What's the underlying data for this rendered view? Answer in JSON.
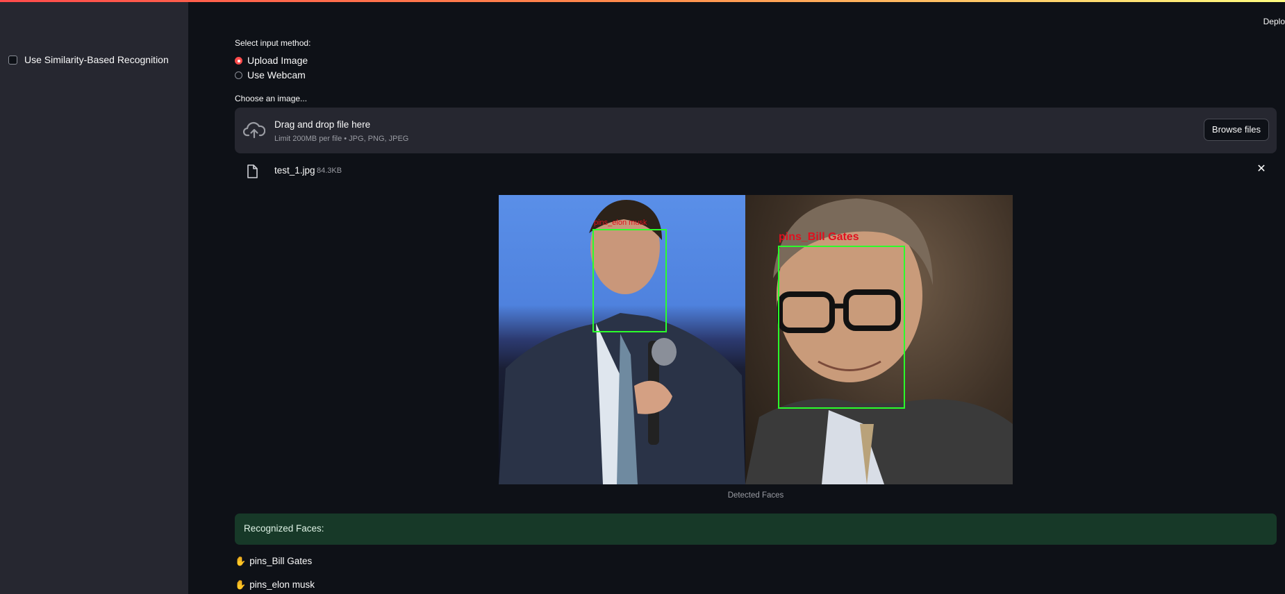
{
  "header": {
    "deploy_label": "Deplo"
  },
  "sidebar": {
    "similarity_checkbox_label": "Use Similarity-Based Recognition",
    "similarity_checked": false
  },
  "input_method": {
    "label": "Select input method:",
    "options": [
      {
        "label": "Upload Image",
        "selected": true
      },
      {
        "label": "Use Webcam",
        "selected": false
      }
    ]
  },
  "uploader": {
    "label": "Choose an image...",
    "title": "Drag and drop file here",
    "limit_text": "Limit 200MB per file • JPG, PNG, JPEG",
    "browse_label": "Browse files",
    "file": {
      "name": "test_1.jpg",
      "size": "84.3KB"
    }
  },
  "image": {
    "caption": "Detected Faces",
    "labels": [
      "pins_elon musk",
      "pins_Bill Gates"
    ]
  },
  "results": {
    "heading": "Recognized Faces:",
    "faces": [
      "pins_Bill Gates",
      "pins_elon musk"
    ]
  },
  "colors": {
    "accent": "#ff4b4b",
    "success_bg": "#173928",
    "box_green": "#2bff2b",
    "box_label_red": "#e0101f"
  },
  "icons": {
    "upload": "cloud-upload-icon",
    "file": "file-icon",
    "close": "close-icon",
    "hand": "raised-hand-icon"
  }
}
